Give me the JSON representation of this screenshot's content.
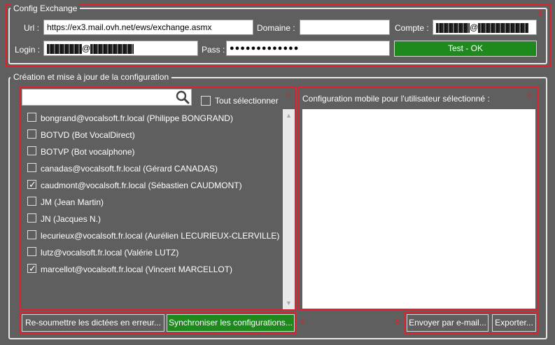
{
  "config": {
    "legend": "Config Exchange",
    "region_number": "1",
    "url_label": "Url :",
    "url_value": "https://ex3.mail.ovh.net/ews/exchange.asmx",
    "domaine_label": "Domaine :",
    "domaine_value": "",
    "compte_label": "Compte :",
    "compte_value": "@",
    "login_label": "Login :",
    "login_value": "@",
    "pass_label": "Pass :",
    "pass_value": "●●●●●●●●●●●●●",
    "test_button": "Test - OK"
  },
  "creation": {
    "legend": "Création et mise à jour de la configuration",
    "users_region_number": "2",
    "mobile_region_number": "3",
    "left_buttons_region_number": "4",
    "right_buttons_region_number": "5",
    "search_placeholder": "",
    "select_all_label": "Tout sélectionner",
    "users": [
      {
        "label": "bongrand@vocalsoft.fr.local (Philippe BONGRAND)",
        "checked": false
      },
      {
        "label": "BOTVD (Bot VocalDirect)",
        "checked": false
      },
      {
        "label": "BOTVP (Bot vocalphone)",
        "checked": false
      },
      {
        "label": "canadas@vocalsoft.fr.local (Gérard CANADAS)",
        "checked": false
      },
      {
        "label": "caudmont@vocalsoft.fr.local (Sébastien CAUDMONT)",
        "checked": true
      },
      {
        "label": "JM (Jean Martin)",
        "checked": false
      },
      {
        "label": "JN (Jacques N.)",
        "checked": false
      },
      {
        "label": "lecurieux@vocalsoft.fr.local (Aurélien LECURIEUX-CLERVILLE)",
        "checked": false
      },
      {
        "label": "lutz@vocalsoft.fr.local (Valérie LUTZ)",
        "checked": false
      },
      {
        "label": "marcellot@vocalsoft.fr.local (Vincent MARCELLOT)",
        "checked": true
      }
    ],
    "mobile_label": "Configuration mobile pour l'utilisateur sélectionné :",
    "mobile_text": "",
    "resubmit_button": "Re-soumettre les dictées en erreur...",
    "sync_button": "Synchroniser les configurations...",
    "email_button": "Envoyer par e-mail...",
    "export_button": "Exporter..."
  },
  "colors": {
    "background": "#5f5f5f",
    "accent_green": "#1e8a1e",
    "highlight_red": "#e0202a"
  },
  "icons": {
    "search": "search-icon",
    "scroll_up": "chevron-up-icon",
    "scroll_down": "chevron-down-icon"
  }
}
